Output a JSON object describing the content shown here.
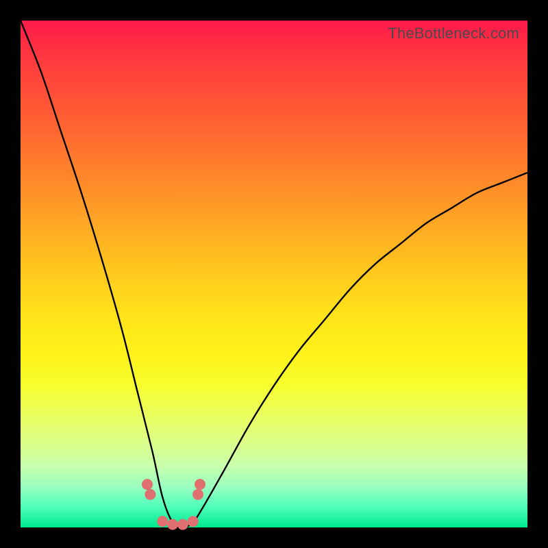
{
  "watermark": "TheBottleneck.com",
  "colors": {
    "frame": "#000000",
    "curve": "#000000",
    "beads": "#e07070",
    "gradient_top": "#ff1a4b",
    "gradient_bottom": "#00e98f"
  },
  "chart_data": {
    "type": "line",
    "title": "",
    "xlabel": "",
    "ylabel": "",
    "xlim": [
      0,
      100
    ],
    "ylim": [
      0,
      100
    ],
    "note": "V-shaped bottleneck curve; minimum bottleneck ≈ 0% around x ≈ 30%. Left arm reaches ≈100% at x=0; right arm rises to ≈70% at x=100. Axis values are estimates — the source image has no tick labels.",
    "series": [
      {
        "name": "bottleneck-curve",
        "x": [
          0,
          4,
          8,
          12,
          16,
          20,
          23,
          26,
          28,
          30,
          32,
          34,
          36,
          40,
          45,
          50,
          55,
          60,
          65,
          70,
          75,
          80,
          85,
          90,
          95,
          100
        ],
        "values": [
          100,
          90,
          78,
          66,
          53,
          39,
          27,
          15,
          6,
          1,
          0,
          1,
          4,
          11,
          20,
          28,
          35,
          41,
          47,
          52,
          56,
          60,
          63,
          66,
          68,
          70
        ]
      }
    ],
    "markers": {
      "name": "bead-markers",
      "x": [
        25,
        25.6,
        28,
        30,
        32,
        34,
        35,
        35.4
      ],
      "values": [
        8.5,
        6.5,
        1.2,
        0.6,
        0.6,
        1.2,
        6.5,
        8.5
      ]
    }
  }
}
